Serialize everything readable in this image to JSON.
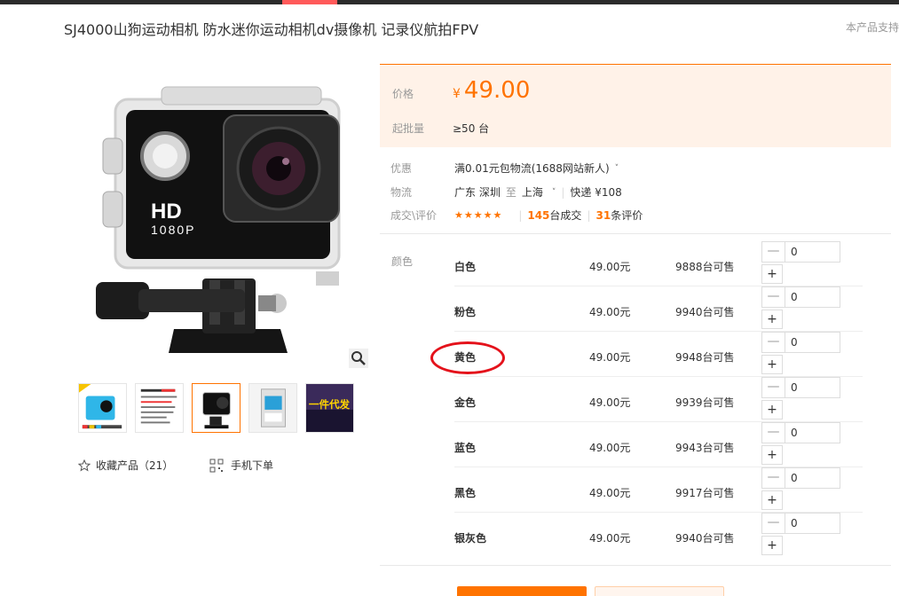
{
  "header": {
    "title": "SJ4000山狗运动相机 防水迷你运动相机dv摄像机 记录仪航拍FPV",
    "support_text": "本产品支持"
  },
  "gallery": {
    "main_image": "HD 1080P action camera in waterproof case",
    "main_badge_line1": "HD",
    "main_badge_line2": "1080P",
    "thumbnails": [
      {
        "desc": "blue camera with color options",
        "active": false
      },
      {
        "desc": "spec sheet",
        "active": false
      },
      {
        "desc": "black camera in case",
        "active": true
      },
      {
        "desc": "camera in retail box",
        "active": false
      },
      {
        "desc": "一件代发 promo",
        "text": "一件代发",
        "active": false
      }
    ],
    "favorite_label": "收藏产品（21）",
    "mobile_order_label": "手机下单"
  },
  "price": {
    "price_label": "价格",
    "currency": "¥",
    "price_value": "49.00",
    "moq_label": "起批量",
    "moq_value": "≥50 台"
  },
  "info": {
    "promo_label": "优惠",
    "promo_value": "满0.01元包物流(1688网站新人)",
    "logistics_label": "物流",
    "from": "广东 深圳",
    "to_word": "至",
    "to": "上海",
    "express": "快递 ¥108",
    "deals_label": "成交\\评价",
    "stars": "★★★★★",
    "deals_count": "145",
    "deals_suffix": "台成交",
    "reviews_count": "31",
    "reviews_suffix": "条评价"
  },
  "sku": {
    "color_label": "颜色",
    "rows": [
      {
        "name": "白色",
        "price": "49.00元",
        "stock": "9888台可售",
        "qty": "0"
      },
      {
        "name": "粉色",
        "price": "49.00元",
        "stock": "9940台可售",
        "qty": "0"
      },
      {
        "name": "黄色",
        "price": "49.00元",
        "stock": "9948台可售",
        "qty": "0"
      },
      {
        "name": "金色",
        "price": "49.00元",
        "stock": "9939台可售",
        "qty": "0"
      },
      {
        "name": "蓝色",
        "price": "49.00元",
        "stock": "9943台可售",
        "qty": "0"
      },
      {
        "name": "黑色",
        "price": "49.00元",
        "stock": "9917台可售",
        "qty": "0"
      },
      {
        "name": "银灰色",
        "price": "49.00元",
        "stock": "9940台可售",
        "qty": "0"
      }
    ],
    "minus": "—",
    "plus": "+"
  },
  "colors": {
    "accent": "#ff7300",
    "price_bg": "#fff2e8",
    "highlight_circle": "#e4121b"
  }
}
